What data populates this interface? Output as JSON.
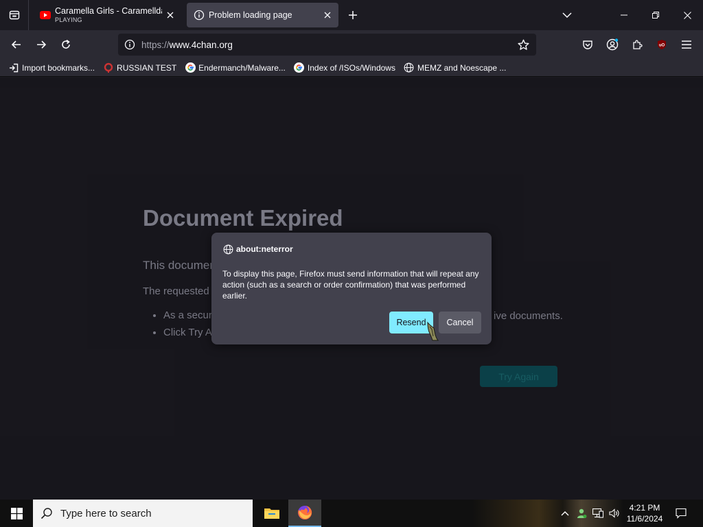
{
  "tabs": [
    {
      "title": "Caramella Girls - Caramelldansen",
      "subtitle": "PLAYING",
      "active": false
    },
    {
      "title": "Problem loading page",
      "active": true
    }
  ],
  "navbar": {
    "url_protocol": "https://",
    "url_host": "www.4chan.org"
  },
  "bookmarks": [
    {
      "label": "Import bookmarks...",
      "icon": "import-icon"
    },
    {
      "label": "RUSSIAN TEST",
      "icon": "red-site-icon"
    },
    {
      "label": "Endermanch/Malware...",
      "icon": "google-icon"
    },
    {
      "label": "Index of /ISOs/Windows",
      "icon": "google-icon"
    },
    {
      "label": "MEMZ and Noescape ...",
      "icon": "globe-icon"
    }
  ],
  "error_page": {
    "title": "Document Expired",
    "description": "This documen",
    "requested": "The requested",
    "bullets": [
      "As a securi",
      "Click Try A"
    ],
    "bullet_tail": "ive documents.",
    "try_again": "Try Again"
  },
  "dialog": {
    "title": "about:neterror",
    "body": "To display this page, Firefox must send information that will repeat any action (such as a search or order confirmation) that was performed earlier.",
    "resend_label": "Resend",
    "cancel_label": "Cancel"
  },
  "taskbar": {
    "search_placeholder": "Type here to search",
    "time": "4:21 PM",
    "date": "11/6/2024"
  },
  "colors": {
    "accent": "#80ebff",
    "chrome_bg": "#2b2a33",
    "tab_bg": "#1c1b22",
    "dialog_bg": "#42414d"
  }
}
